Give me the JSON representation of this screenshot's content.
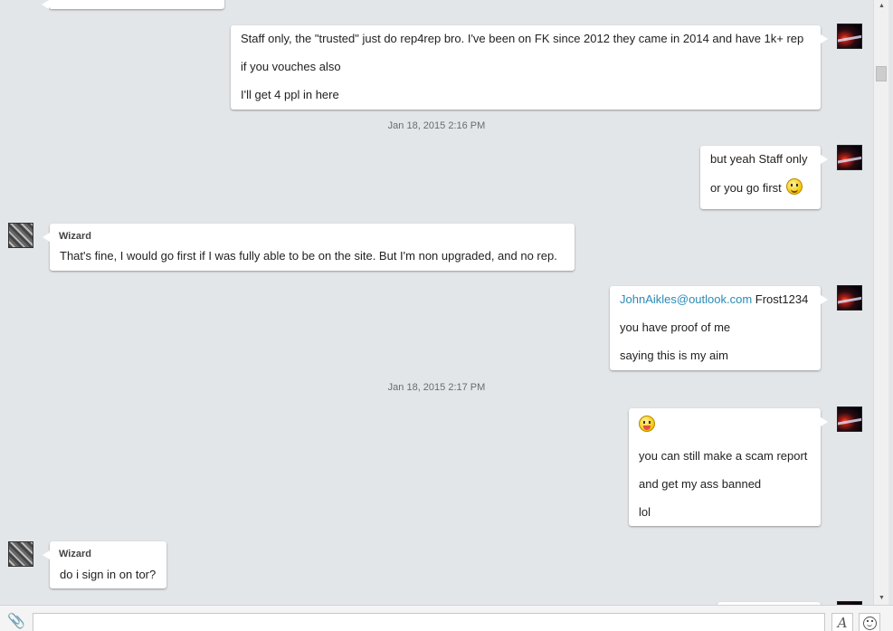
{
  "messages": {
    "m1": {
      "line1": "Staff only, the \"trusted\" just do rep4rep bro. I've been on FK since 2012 they came in 2014 and have 1k+ rep",
      "line2": "if you vouches also",
      "line3": "I'll get 4 ppl in here"
    },
    "ts1": "Jan 18, 2015 2:16 PM",
    "m2": {
      "line1": "but yeah Staff only",
      "line2": "or you go first"
    },
    "w1": {
      "sender": "Wizard",
      "text": "That's fine, I would go first if I was fully able to be on the site. But I'm non upgraded, and no rep."
    },
    "m3": {
      "email": "JohnAikles@outlook.com",
      "password": "Frost1234",
      "line2": "you have proof of me",
      "line3": "saying this is my aim"
    },
    "ts2": "Jan 18, 2015 2:17 PM",
    "m4": {
      "line1": "you can still make a scam report",
      "line2": "and get my ass banned",
      "line3": "lol"
    },
    "w2": {
      "sender": "Wizard",
      "text": "do i sign in on tor?"
    }
  },
  "composer": {
    "placeholder": "",
    "format_label": "A"
  },
  "icons": {
    "attach": "paperclip-icon",
    "emoji": "smiley-icon",
    "smile_emoticon": "smile-emoticon-icon",
    "tongue_emoticon": "tongue-emoticon-icon"
  }
}
